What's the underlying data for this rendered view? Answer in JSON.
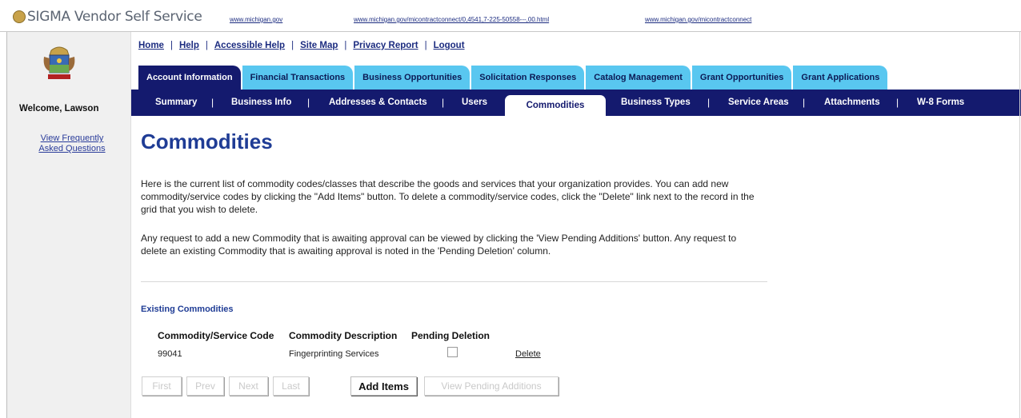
{
  "header": {
    "brand": "SIGMA Vendor Self Service",
    "links": [
      "www.michigan.gov",
      "www.michigan.gov/micontractconnect/0,4541,7-225-50558---,00.html",
      "www.michigan.gov/micontractconnect"
    ]
  },
  "sidebar": {
    "welcome": "Welcome, Lawson",
    "faq_line1": "View Frequently",
    "faq_line2": "Asked Questions"
  },
  "utility_nav": [
    "Home",
    "Help",
    "Accessible Help",
    "Site Map",
    "Privacy Report",
    "Logout"
  ],
  "tabs": [
    {
      "label": "Account Information",
      "active": true
    },
    {
      "label": "Financial Transactions",
      "active": false
    },
    {
      "label": "Business Opportunities",
      "active": false
    },
    {
      "label": "Solicitation Responses",
      "active": false
    },
    {
      "label": "Catalog Management",
      "active": false
    },
    {
      "label": "Grant Opportunities",
      "active": false
    },
    {
      "label": "Grant Applications",
      "active": false
    }
  ],
  "subnav": [
    "Summary",
    "Business Info",
    "Addresses & Contacts",
    "Users",
    "Commodities",
    "Business Types",
    "Service Areas",
    "Attachments",
    "W-8 Forms"
  ],
  "subnav_separator": "|",
  "page": {
    "title": "Commodities",
    "intro": "Here is the current list of commodity codes/classes that describe the goods and services that your organization provides. You can add new commodity/service codes by clicking the \"Add Items\" button. To delete a commodity/service codes, click the \"Delete\" link next to the record in the grid that you wish to delete.",
    "pending_note": "Any request to add a new Commodity that is awaiting approval can be viewed by clicking the 'View Pending Additions' button. Any request to delete an existing Commodity that is awaiting approval is noted in the 'Pending Deletion' column.",
    "section_label": "Existing Commodities"
  },
  "table": {
    "headers": [
      "Commodity/Service Code",
      "Commodity Description",
      "Pending Deletion"
    ],
    "rows": [
      {
        "code": "99041",
        "description": "Fingerprinting Services",
        "pending_deletion": false,
        "action": "Delete"
      }
    ]
  },
  "buttons": {
    "first": "First",
    "prev": "Prev",
    "next": "Next",
    "last": "Last",
    "add_items": "Add Items",
    "view_pending": "View Pending Additions"
  },
  "colors": {
    "tab_inactive": "#59c7f0",
    "tab_active": "#141a6e",
    "subnav_bg": "#141a6e",
    "title": "#1f3c95",
    "link": "#1c2c80"
  }
}
